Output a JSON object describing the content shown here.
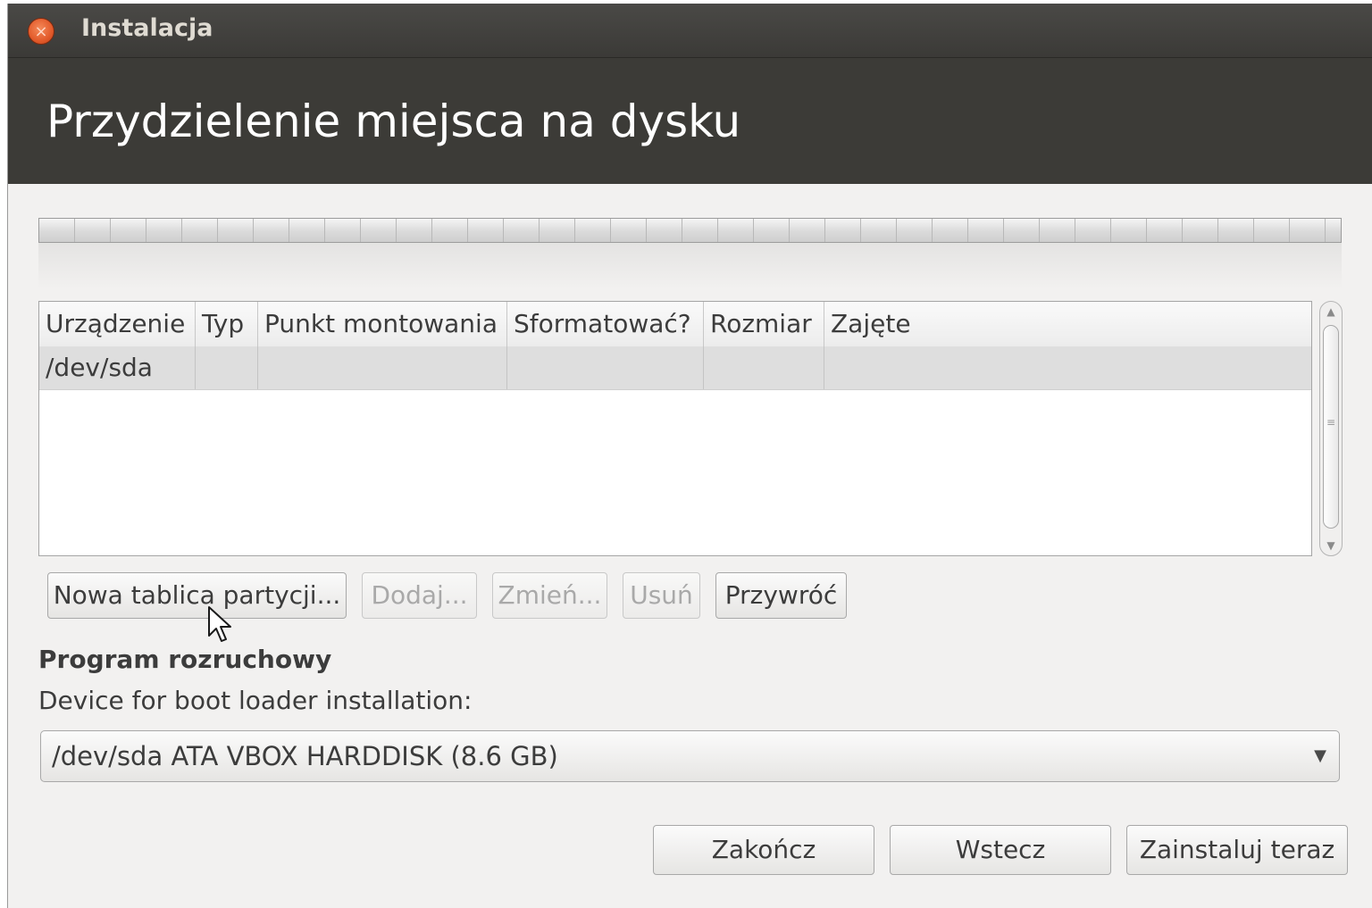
{
  "window": {
    "title": "Instalacja",
    "close_glyph": "×"
  },
  "page": {
    "title": "Przydzielenie miejsca na dysku"
  },
  "table": {
    "columns": [
      "Urządzenie",
      "Typ",
      "Punkt montowania",
      "Sformatować?",
      "Rozmiar",
      "Zajęte"
    ],
    "rows": [
      {
        "device": "/dev/sda",
        "type": "",
        "mount": "",
        "format": "",
        "size": "",
        "used": ""
      }
    ]
  },
  "scrollbar": {
    "up": "▲",
    "down": "▼",
    "grip": "≡"
  },
  "buttons": {
    "new_table": "Nowa tablica partycji...",
    "add": "Dodaj...",
    "change": "Zmień...",
    "delete": "Usuń",
    "revert": "Przywróć"
  },
  "bootloader": {
    "section": "Program rozruchowy",
    "label": "Device for boot loader installation:",
    "value": "/dev/sda ATA VBOX HARDDISK (8.6 GB)",
    "arrow": "▼"
  },
  "footer": {
    "quit": "Zakończ",
    "back": "Wstecz",
    "install": "Zainstaluj teraz"
  },
  "colors": {
    "header": "#3c3b37",
    "close": "#e25a2a",
    "background": "#f2f1f0"
  },
  "icons": {
    "close": "close-icon",
    "cursor": "mouse-pointer-icon",
    "dropdown": "chevron-down-icon"
  }
}
